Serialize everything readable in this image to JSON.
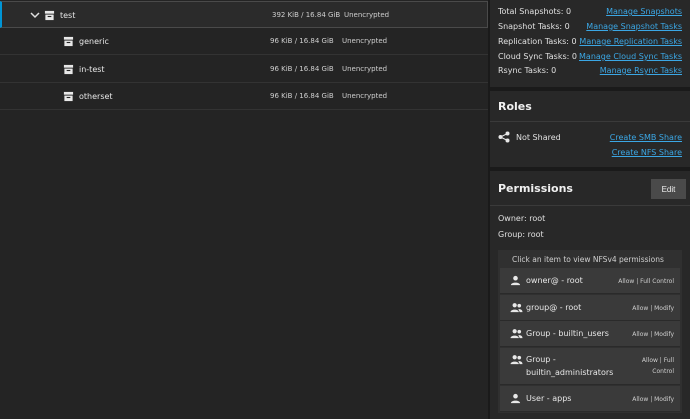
{
  "datasets": [
    {
      "name": "test",
      "used": "392 KiB / 16.84 GiB",
      "encryption": "Unencrypted",
      "expanded": true
    },
    {
      "name": "generic",
      "used": "96 KiB / 16.84 GiB",
      "encryption": "Unencrypted"
    },
    {
      "name": "in-test",
      "used": "96 KiB / 16.84 GiB",
      "encryption": "Unencrypted"
    },
    {
      "name": "otherset",
      "used": "96 KiB / 16.84 GiB",
      "encryption": "Unencrypted"
    }
  ],
  "data_protection": [
    {
      "label": "Total Snapshots: 0",
      "link": "Manage Snapshots"
    },
    {
      "label": "Snapshot Tasks: 0",
      "link": "Manage Snapshot Tasks"
    },
    {
      "label": "Replication Tasks: 0",
      "link": "Manage Replication Tasks"
    },
    {
      "label": "Cloud Sync Tasks: 0",
      "link": "Manage Cloud Sync Tasks"
    },
    {
      "label": "Rsync Tasks: 0",
      "link": "Manage Rsync Tasks"
    }
  ],
  "roles": {
    "title": "Roles",
    "status": "Not Shared",
    "smb_link": "Create SMB Share",
    "nfs_link": "Create NFS Share"
  },
  "permissions": {
    "title": "Permissions",
    "edit_label": "Edit",
    "owner": "Owner: root",
    "group": "Group: root",
    "hint": "Click an item to view NFSv4 permissions",
    "acl": [
      {
        "who": "owner@ - root",
        "perm": "Allow | Full Control",
        "icon": "user-icon"
      },
      {
        "who": "group@ - root",
        "perm": "Allow | Modify",
        "icon": "group-icon"
      },
      {
        "who": "Group - builtin_users",
        "perm": "Allow | Modify",
        "icon": "group-icon"
      },
      {
        "who": "Group - builtin_administrators",
        "perm": "Allow | Full Control",
        "icon": "group-icon"
      },
      {
        "who": "User - apps",
        "perm": "Allow | Modify",
        "icon": "user-icon"
      }
    ]
  },
  "colors": {
    "accent": "#0095d5",
    "link": "#3ba7e5"
  }
}
